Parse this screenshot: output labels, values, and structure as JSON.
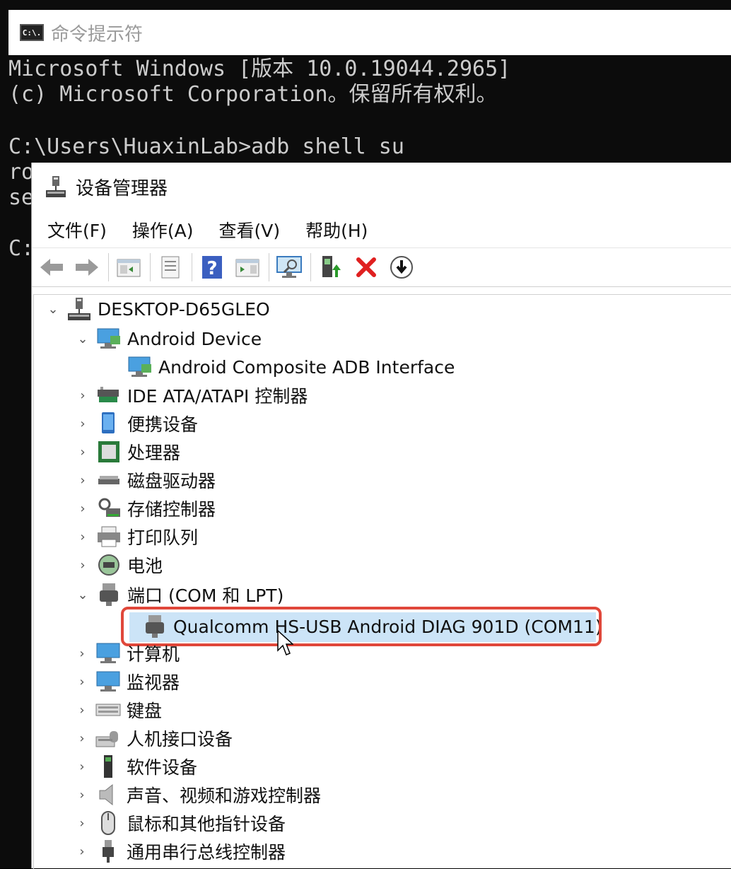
{
  "cmd": {
    "title": "命令提示符",
    "icon_text": "C:\\.",
    "lines": [
      "Microsoft Windows [版本 10.0.19044.2965]",
      "(c) Microsoft Corporation。保留所有权利。",
      "",
      "C:\\Users\\HuaxinLab>adb shell su",
      "ro",
      "se",
      "",
      "C:"
    ]
  },
  "devmgr": {
    "title": "设备管理器",
    "menu": [
      "文件(F)",
      "操作(A)",
      "查看(V)",
      "帮助(H)"
    ],
    "toolbar_icons": [
      "back-arrow-icon",
      "forward-arrow-icon",
      "show-hide-console-tree-icon",
      "properties-icon",
      "help-icon",
      "action-pane-icon",
      "scan-hardware-icon",
      "update-driver-icon",
      "uninstall-device-icon",
      "disable-device-icon"
    ],
    "tree": {
      "root": "DESKTOP-D65GLEO",
      "items": [
        {
          "label": "Android Device",
          "expanded": true,
          "level": 1
        },
        {
          "label": "Android Composite ADB Interface",
          "level": 2
        },
        {
          "label": "IDE ATA/ATAPI 控制器",
          "level": 1
        },
        {
          "label": "便携设备",
          "level": 1
        },
        {
          "label": "处理器",
          "level": 1
        },
        {
          "label": "磁盘驱动器",
          "level": 1
        },
        {
          "label": "存储控制器",
          "level": 1
        },
        {
          "label": "打印队列",
          "level": 1
        },
        {
          "label": "电池",
          "level": 1
        },
        {
          "label": "端口 (COM 和 LPT)",
          "expanded": true,
          "level": 1
        },
        {
          "label": "Qualcomm HS-USB Android DIAG 901D (COM11)",
          "level": 2,
          "highlighted": true
        },
        {
          "label": "计算机",
          "level": 1
        },
        {
          "label": "监视器",
          "level": 1
        },
        {
          "label": "键盘",
          "level": 1
        },
        {
          "label": "人机接口设备",
          "level": 1
        },
        {
          "label": "软件设备",
          "level": 1
        },
        {
          "label": "声音、视频和游戏控制器",
          "level": 1
        },
        {
          "label": "鼠标和其他指针设备",
          "level": 1
        },
        {
          "label": "通用串行总线控制器",
          "level": 1
        }
      ]
    },
    "highlight_color": "#e0473a"
  }
}
